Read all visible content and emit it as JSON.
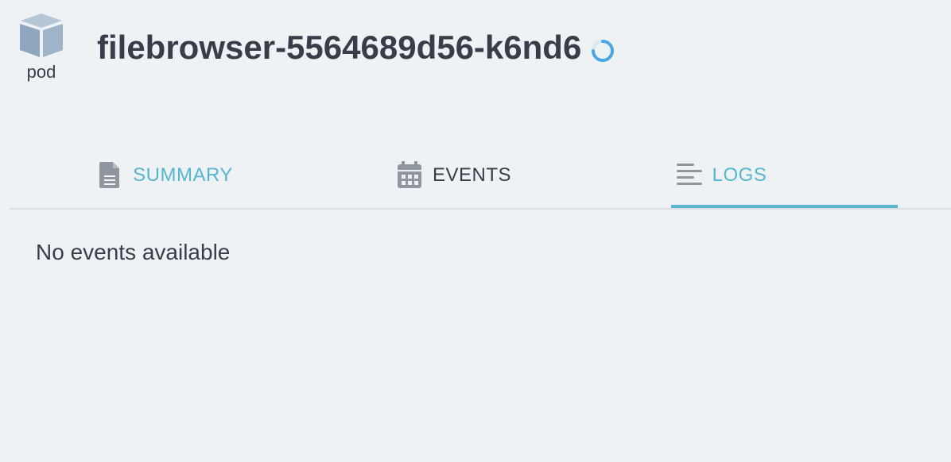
{
  "header": {
    "kind": {
      "icon": "cube-icon",
      "label": "pod"
    },
    "title": "filebrowser-5564689d56-k6nd6",
    "status_icon": "loading-spinner-icon",
    "status_color": "#4aa7e6"
  },
  "tabs": [
    {
      "label": "SUMMARY",
      "icon": "document-icon",
      "active": false
    },
    {
      "label": "EVENTS",
      "icon": "calendar-icon",
      "active": true
    },
    {
      "label": "LOGS",
      "icon": "lines-icon",
      "active": false
    }
  ],
  "colors": {
    "background": "#eff2f5",
    "text": "#383d4a",
    "link": "#55b6cf",
    "accent": "#5bb8cf",
    "icon_gray": "#8f96a0",
    "cube_blue": "#8ea7bf"
  },
  "content": {
    "message": "No events available"
  }
}
